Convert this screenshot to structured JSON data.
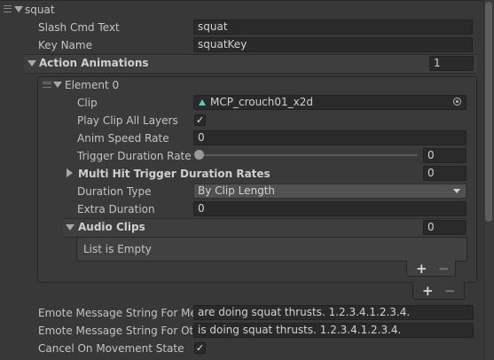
{
  "component": {
    "title": "squat"
  },
  "fields": {
    "slash_cmd": {
      "label": "Slash Cmd Text",
      "value": "squat"
    },
    "key_name": {
      "label": "Key Name",
      "value": "squatKey"
    }
  },
  "action_animations": {
    "label": "Action Animations",
    "count": "1",
    "element": {
      "label": "Element 0",
      "clip": {
        "label": "Clip",
        "value": "MCP_crouch01_x2d"
      },
      "play_all_layers": {
        "label": "Play Clip All Layers",
        "checked": "✓"
      },
      "anim_speed": {
        "label": "Anim Speed Rate",
        "value": "0"
      },
      "trigger_duration": {
        "label": "Trigger Duration Rate",
        "value": "0"
      },
      "multi_hit": {
        "label": "Multi Hit Trigger Duration Rates",
        "count": "0"
      },
      "duration_type": {
        "label": "Duration Type",
        "value": "By Clip Length"
      },
      "extra_duration": {
        "label": "Extra Duration",
        "value": "0"
      },
      "audio_clips": {
        "label": "Audio Clips",
        "count": "0",
        "empty_text": "List is Empty"
      }
    },
    "add_symbol": "+",
    "remove_symbol": "−"
  },
  "emote": {
    "me": {
      "label": "Emote Message String For Me",
      "value": "are doing squat thrusts. 1.2.3.4.1.2.3.4."
    },
    "others": {
      "label": "Emote Message String For Othe",
      "value": "is doing squat thrusts. 1.2.3.4.1.2.3.4."
    }
  },
  "cancel_on_movement": {
    "label": "Cancel On Movement State",
    "checked": "✓"
  },
  "icons": {
    "expand": "triangle-down-icon",
    "collapse": "triangle-right-icon",
    "drag": "drag-handle-icon",
    "clip": "animation-clip-icon",
    "object_picker": "object-picker-icon",
    "dropdown": "dropdown-arrow-icon"
  }
}
